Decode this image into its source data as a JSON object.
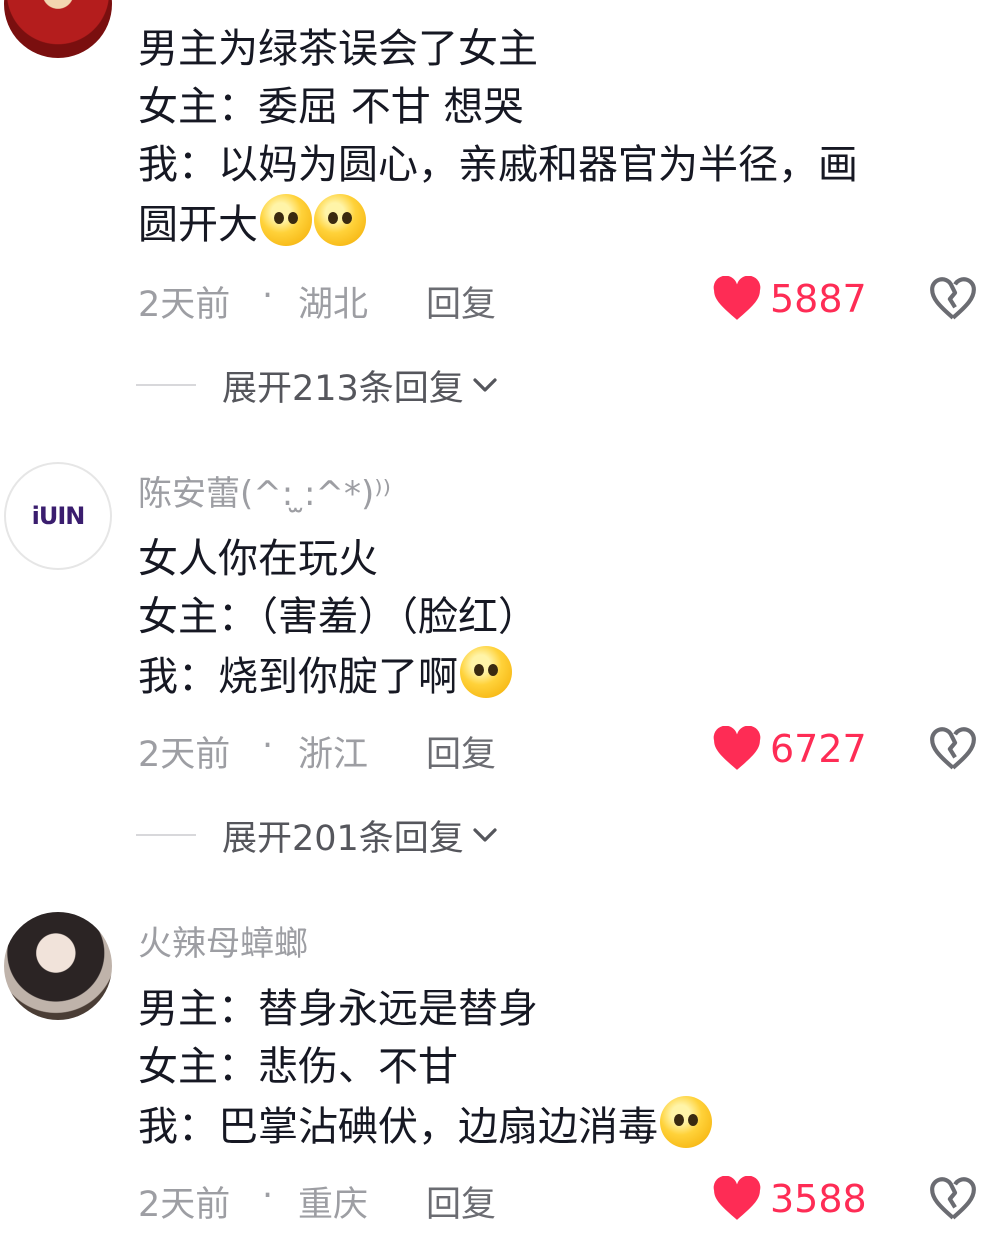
{
  "comments": [
    {
      "username": "",
      "lines": [
        "男主为绿茶误会了女主",
        "女主：委屈 不甘 想哭",
        "我：以妈为圆心，亲戚和器官为半径，画",
        "圆开大"
      ],
      "emoji_count": 2,
      "time": "2天前",
      "separator": "·",
      "location": "湖北",
      "reply_label": "回复",
      "likes": "5887",
      "expand_label": "展开213条回复"
    },
    {
      "username": "陈安蕾(^: ̫:^*)⁾⁾",
      "avatar_text": "iUIN",
      "lines": [
        "女人你在玩火",
        "女主：（害羞）（脸红）",
        "我：烧到你腚了啊"
      ],
      "emoji_count": 1,
      "time": "2天前",
      "separator": "·",
      "location": "浙江",
      "reply_label": "回复",
      "likes": "6727",
      "expand_label": "展开201条回复"
    },
    {
      "username": "火辣母蟑螂",
      "lines": [
        "男主：替身永远是替身",
        "女主：悲伤、不甘",
        "我：巴掌沾碘伏，边扇边消毒"
      ],
      "emoji_count": 1,
      "time": "2天前",
      "separator": "·",
      "location": "重庆",
      "reply_label": "回复",
      "likes": "3588"
    }
  ],
  "colors": {
    "like": "#fe2c55",
    "meta": "#9d9ea3",
    "text": "#161823"
  }
}
